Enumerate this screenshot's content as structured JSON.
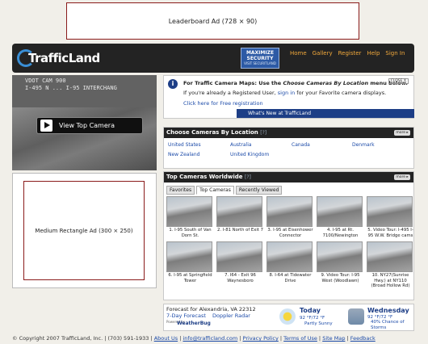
{
  "ads": {
    "leaderboard": "Leaderboard Ad (728 × 90)",
    "rectangle": "Medium Rectangle Ad (300 × 250)"
  },
  "header": {
    "logo": "TrafficLand",
    "promo_line1": "MAXIMIZE",
    "promo_line2": "SECURITY",
    "promo_line3": "VISIT SECURITLAND",
    "nav": [
      "Home",
      "Gallery",
      "Register",
      "Help",
      "Sign In"
    ]
  },
  "video": {
    "overlay_line1": "VDOT CAM 900",
    "overlay_line2": "I-495 N ... I-95 INTERCHANG",
    "button": "View Top Camera"
  },
  "info": {
    "line1_prefix": "For Traffic Camera Maps: Use the",
    "line1_em": "Choose Cameras By Location",
    "line1_suffix": "menu below.",
    "line2_prefix": "If you're already a Registered User,",
    "line2_link": "sign in",
    "line2_suffix": "for your Favorite camera displays.",
    "line3": "Click here for Free registration",
    "close": "CLOSE X",
    "bar": "What's New at TrafficLand"
  },
  "locations": {
    "title": "Choose Cameras By Location",
    "help": "[?]",
    "more": "more ▸",
    "items": [
      "United States",
      "Australia",
      "Canada",
      "Denmark",
      "New Zealand",
      "United Kingdom"
    ]
  },
  "top_cameras": {
    "title": "Top Cameras Worldwide",
    "help": "[?]",
    "more": "more ▸",
    "tabs": [
      "Favorites",
      "Top Cameras",
      "Recently Viewed"
    ],
    "cams": [
      "1. I-95 South of Van Dorn St.",
      "2. I-81 North of Exit 7",
      "3. I-95 at Eisenhower Connector",
      "4. I-95 at Rt. 7100/Newington",
      "5. Video Tour: I-495 I-95 W.W. Bridge cams",
      "6. I-95 at Springfield Tower",
      "7. I64 - Exit 96 Waynesboro",
      "8. I-64 at Tidewater Drive",
      "9. Video Tour: I-95 West (Woodlawn)",
      "10. NY27(Sunrise Hwy.) at NY110 (Broad Hollow Rd)"
    ]
  },
  "weather": {
    "forecast": "Forecast for Alexandria, VA 22312",
    "link1": "7-Day Forecast",
    "link2": "Doppler Radar",
    "powered": "Powered by",
    "brand": "WeatherBug",
    "today": "Today",
    "today_temp": "92 °F/72 °F",
    "today_cond": "Partly Sunny",
    "wed": "Wednesday",
    "wed_temp": "92 °F/72 °F",
    "wed_cond1": "40% Chance of",
    "wed_cond2": "Storms"
  },
  "footer": {
    "copy": "© Copyright 2007 TrafficLand, Inc. | (703) 591-1933 |",
    "links": [
      "About Us",
      "info@trafficland.com",
      "Privacy Policy",
      "Terms of Use",
      "Site Map",
      "Feedback"
    ]
  }
}
